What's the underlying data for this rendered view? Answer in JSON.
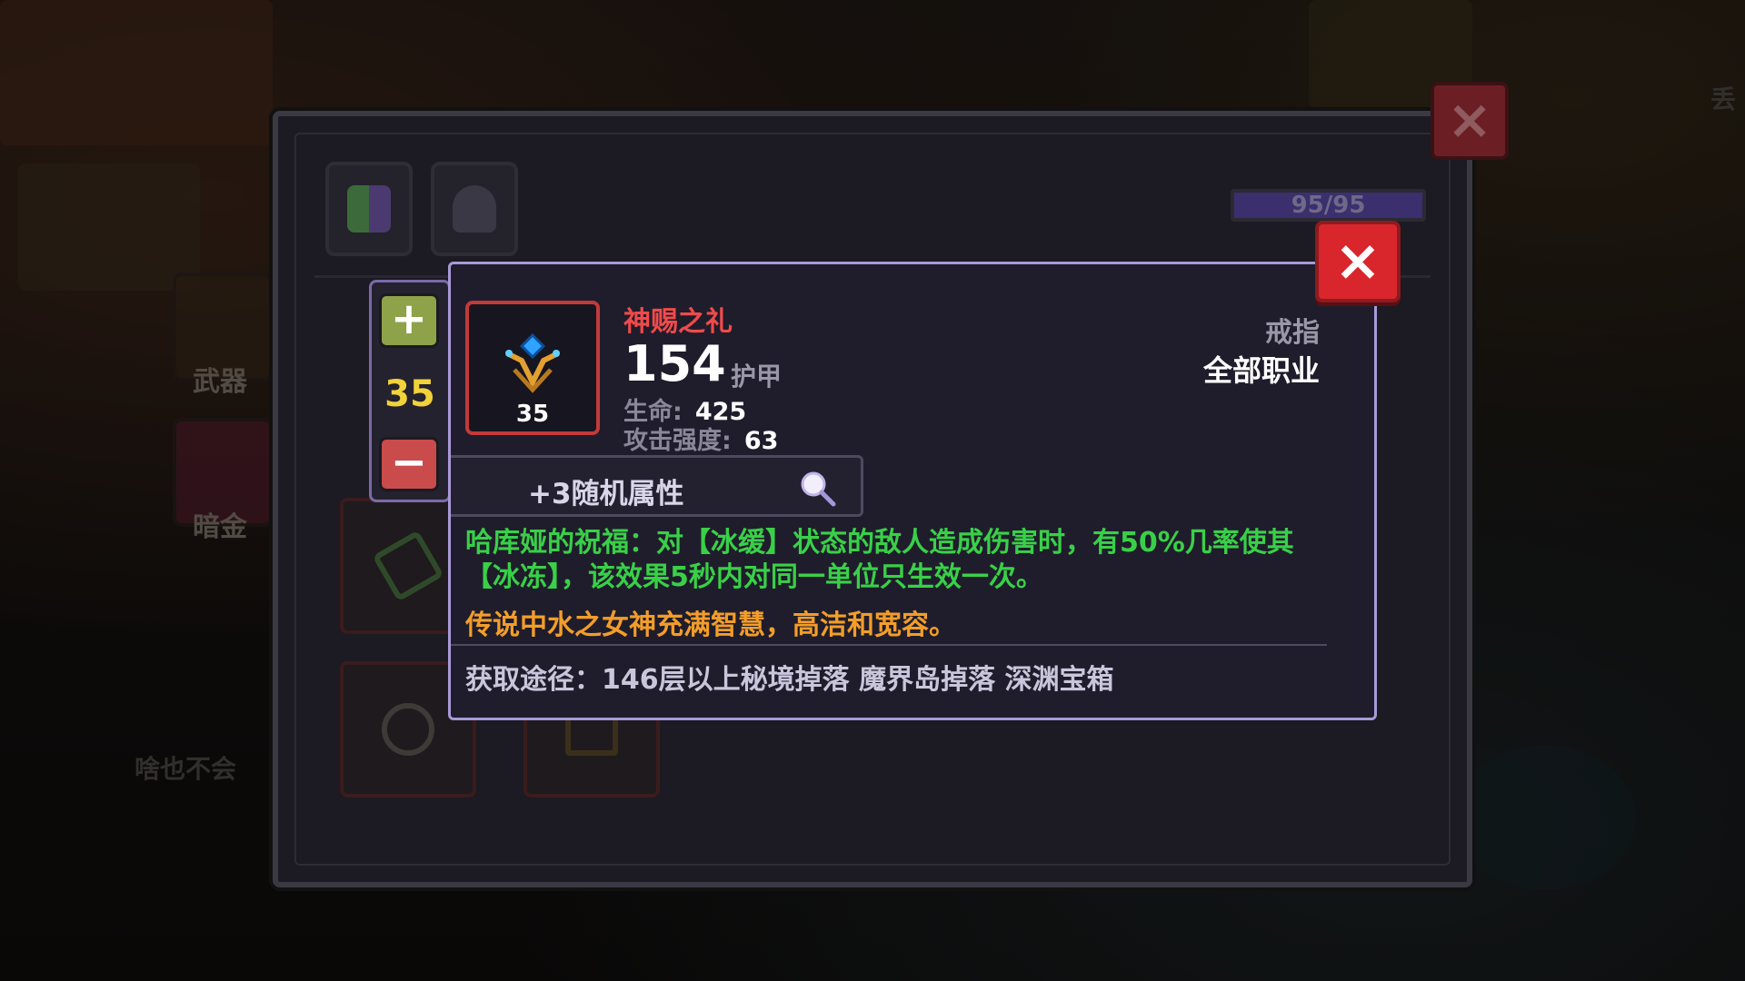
{
  "background": {
    "side_buttons": [
      {
        "label": "武器"
      },
      {
        "label": "暗金"
      }
    ],
    "faint_caption": "啥也不会",
    "corner_text": "丢"
  },
  "inventory": {
    "capacity": "95/95",
    "close_icon": "×"
  },
  "stepper": {
    "plus": "+",
    "value": "35",
    "minus": "−"
  },
  "tooltip": {
    "item_name": "神赐之礼",
    "item_level": "35",
    "armor_value": "154",
    "armor_label": "护甲",
    "stats": [
      {
        "key": "生命:",
        "value": "425"
      },
      {
        "key": "攻击强度:",
        "value": "63"
      }
    ],
    "item_type": "戒指",
    "item_class": "全部职业",
    "random_attrs": "+3随机属性",
    "desc_effect": "哈库娅的祝福：对【冰缓】状态的敌人造成伤害时，有50%几率使其【冰冻】，该效果5秒内对同一单位只生效一次。",
    "desc_lore": "传说中水之女神充满智慧，高洁和宽容。",
    "source": "获取途径：146层以上秘境掉落 魔界岛掉落 深渊宝箱",
    "close_icon": "×",
    "colors": {
      "name": "#f04a4a",
      "effect": "#39d048",
      "lore": "#f39d2a",
      "frame": "#c23a3a"
    }
  }
}
